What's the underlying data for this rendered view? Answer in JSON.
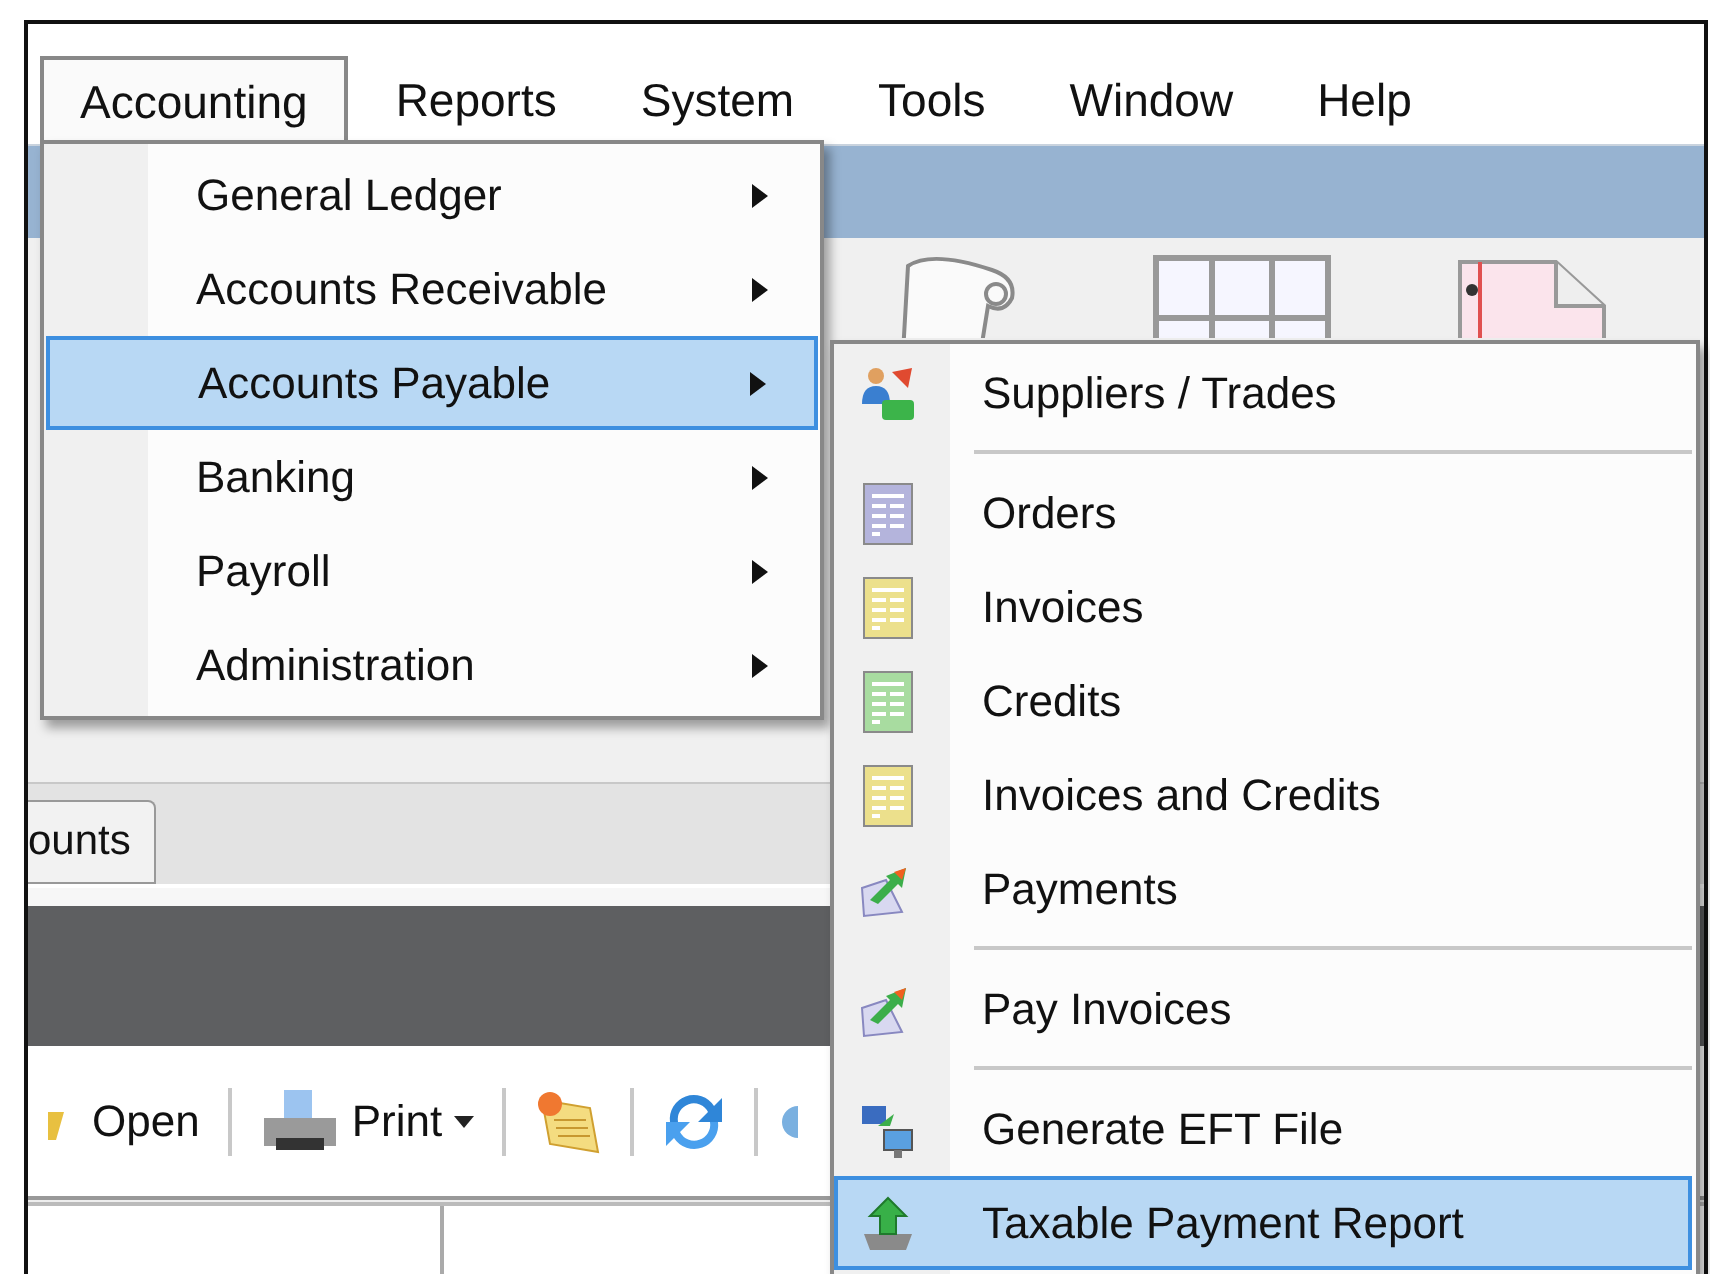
{
  "menubar": [
    {
      "label": "Accounting",
      "selected": true
    },
    {
      "label": "Reports",
      "selected": false
    },
    {
      "label": "System",
      "selected": false
    },
    {
      "label": "Tools",
      "selected": false
    },
    {
      "label": "Window",
      "selected": false
    },
    {
      "label": "Help",
      "selected": false
    }
  ],
  "accounting_menu": {
    "items": [
      {
        "label": "General Ledger",
        "selected": false
      },
      {
        "label": "Accounts Receivable",
        "selected": false
      },
      {
        "label": "Accounts Payable",
        "selected": true
      },
      {
        "label": "Banking",
        "selected": false
      },
      {
        "label": "Payroll",
        "selected": false
      },
      {
        "label": "Administration",
        "selected": false
      }
    ]
  },
  "submenu": {
    "groups": [
      [
        {
          "label": "Suppliers / Trades",
          "kind": "suppliers",
          "selected": false
        }
      ],
      [
        {
          "label": "Orders",
          "kind": "document",
          "color": "#b4b4dc",
          "selected": false
        },
        {
          "label": "Invoices",
          "kind": "document",
          "color": "#ece08c",
          "selected": false
        },
        {
          "label": "Credits",
          "kind": "document",
          "color": "#a8dca0",
          "selected": false
        },
        {
          "label": "Invoices and Credits",
          "kind": "document",
          "color": "#ece08c",
          "selected": false
        },
        {
          "label": "Payments",
          "kind": "payment",
          "selected": false
        }
      ],
      [
        {
          "label": "Pay Invoices",
          "kind": "payment",
          "selected": false
        }
      ],
      [
        {
          "label": "Generate EFT File",
          "kind": "eft",
          "selected": false
        },
        {
          "label": "Taxable Payment Report",
          "kind": "upload",
          "selected": true
        }
      ]
    ]
  },
  "tabs": [
    {
      "label": "ounts",
      "selected": true
    }
  ],
  "toolbar": [
    {
      "label": "Open",
      "kind": "open"
    },
    {
      "label": "Print",
      "kind": "print"
    },
    {
      "kind": "certificate"
    },
    {
      "kind": "refresh"
    },
    {
      "kind": "partial"
    }
  ]
}
